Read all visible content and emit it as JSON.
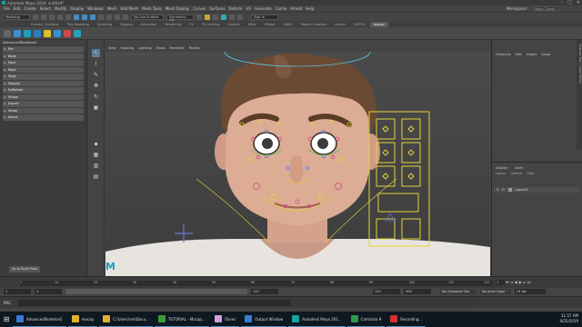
{
  "title": "Autodesk Maya 2016: untitled*",
  "menus": [
    "File",
    "Edit",
    "Create",
    "Select",
    "Modify",
    "Display",
    "Windows",
    "Mesh",
    "Edit Mesh",
    "Mesh Tools",
    "Mesh Display",
    "Curves",
    "Surfaces",
    "Deform",
    "UV",
    "Generate",
    "Cache",
    "Arnold",
    "Help"
  ],
  "status": {
    "mode": "Modeling",
    "live_surface": "No Live Surface",
    "symmetry": "Symmetry: Off",
    "target": "Sign in",
    "workspace_label": "Workspace:",
    "workspace": "Maya Classic"
  },
  "shelf_tabs": [
    "Curves / Surfaces",
    "Poly Modeling",
    "Sculpting",
    "Rigging",
    "Animation",
    "Rendering",
    "FX",
    "FX Caching",
    "Custom",
    "XGen",
    "Bifrost",
    "MASH",
    "Motion Graphics",
    "Arnold",
    "TURTLE",
    "mocap"
  ],
  "shelf_active": "mocap",
  "left_panel": {
    "header": "AdvancedSkeleton5",
    "items": [
      "Pre",
      "Body",
      "Face",
      "Pose",
      "Tools",
      "Display",
      "DeRotate",
      "Shape",
      "Export",
      "Views",
      "About"
    ],
    "build_pose": "Go to Build Pose"
  },
  "viewport_menu": [
    "View",
    "Shading",
    "Lighting",
    "Show",
    "Renderer",
    "Panels"
  ],
  "channel_box": {
    "tabs": [
      "Channels",
      "Edit",
      "Object",
      "Show"
    ]
  },
  "layer_panel": {
    "tabs": [
      "Display",
      "Anim"
    ],
    "sub": [
      "Layers",
      "Options",
      "Help"
    ],
    "layer_v": "V",
    "layer_p": "P",
    "layer_name": "Layer15"
  },
  "timeline": {
    "ticks": [
      "1",
      "10",
      "20",
      "30",
      "40",
      "50",
      "60",
      "70",
      "80",
      "90",
      "100",
      "110",
      "120"
    ],
    "current": "1"
  },
  "range": {
    "start": "1",
    "start2": "1",
    "end_inner": "120",
    "end_inner2": "120",
    "end": "200",
    "character": "No Character Set",
    "anim_layer": "No Anim Layer",
    "fps": "24 fps"
  },
  "command": {
    "label": "MEL"
  },
  "taskbar": {
    "tasks": [
      {
        "label": "AdvancedSkeleton5",
        "color": "#3a7bd5"
      },
      {
        "label": "mocap",
        "color": "#e0b030"
      },
      {
        "label": "C:\\Users\\me\\Docu...",
        "color": "#e0b030"
      },
      {
        "label": "TUTORIAL - Mocap...",
        "color": "#3a9a3a"
      },
      {
        "label": "iTunes",
        "color": "#d0a0e0"
      },
      {
        "label": "Output Window",
        "color": "#3a7bd5"
      },
      {
        "label": "Autodesk Maya 201...",
        "color": "#1ca0a0"
      },
      {
        "label": "Camtasia 9",
        "color": "#2a9a4a"
      },
      {
        "label": "Recording...",
        "color": "#d03030"
      }
    ],
    "time": "11:57 AM",
    "date": "9/25/2019"
  },
  "colors": {
    "accent": "#4a8dc2",
    "viewport": "#474747",
    "controls_yellow": "#e6d23a"
  }
}
